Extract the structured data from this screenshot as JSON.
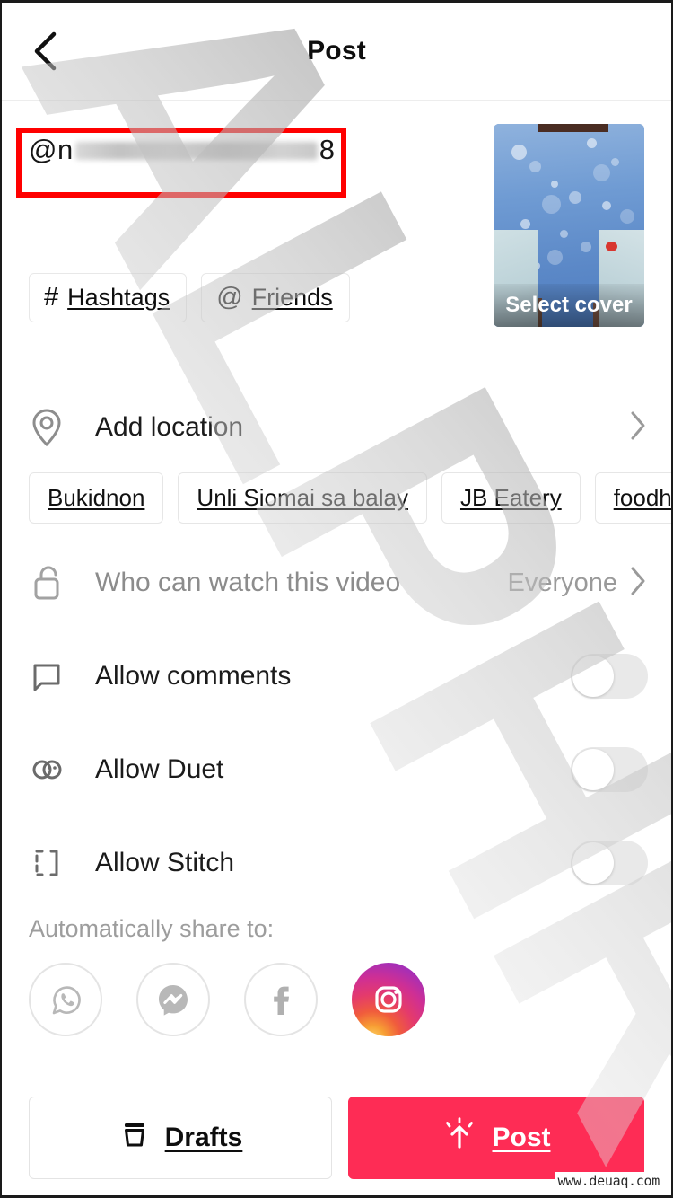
{
  "header": {
    "title": "Post",
    "back_icon": "chevron-left-icon"
  },
  "caption": {
    "prefix": "@n",
    "suffix": "8",
    "redacted": true,
    "annotation_color": "#ff0000"
  },
  "tag_buttons": [
    {
      "glyph": "#",
      "label": "Hashtags",
      "icon": "hashtag-icon"
    },
    {
      "glyph": "@",
      "label": "Friends",
      "icon": "at-mention-icon"
    }
  ],
  "cover": {
    "label": "Select cover"
  },
  "location": {
    "label": "Add location",
    "icon": "map-pin-icon",
    "chevron": "chevron-right-icon",
    "suggestions": [
      "Bukidnon",
      "Unli Siomai sa balay",
      "JB Eatery",
      "foodhouz",
      ""
    ]
  },
  "privacy": {
    "label": "Who can watch this video",
    "value": "Everyone",
    "icon": "unlock-icon",
    "chevron": "chevron-right-icon"
  },
  "toggles": [
    {
      "label": "Allow comments",
      "icon": "comment-bubble-icon",
      "on": false
    },
    {
      "label": "Allow Duet",
      "icon": "duet-icon",
      "on": false
    },
    {
      "label": "Allow Stitch",
      "icon": "stitch-icon",
      "on": false
    }
  ],
  "share": {
    "title": "Automatically share to:",
    "targets": [
      {
        "name": "whatsapp-icon",
        "label": "WhatsApp",
        "active": false
      },
      {
        "name": "messenger-icon",
        "label": "Messenger",
        "active": false
      },
      {
        "name": "facebook-icon",
        "label": "Facebook",
        "active": false
      },
      {
        "name": "instagram-icon",
        "label": "Instagram",
        "active": true
      }
    ]
  },
  "bottom": {
    "drafts_label": "Drafts",
    "drafts_icon": "archive-box-icon",
    "post_label": "Post",
    "post_icon": "upload-burst-icon",
    "post_color": "#fe2c55"
  },
  "watermarks": {
    "overlay_text": "ALPHR",
    "site": "www.deuaq.com"
  }
}
